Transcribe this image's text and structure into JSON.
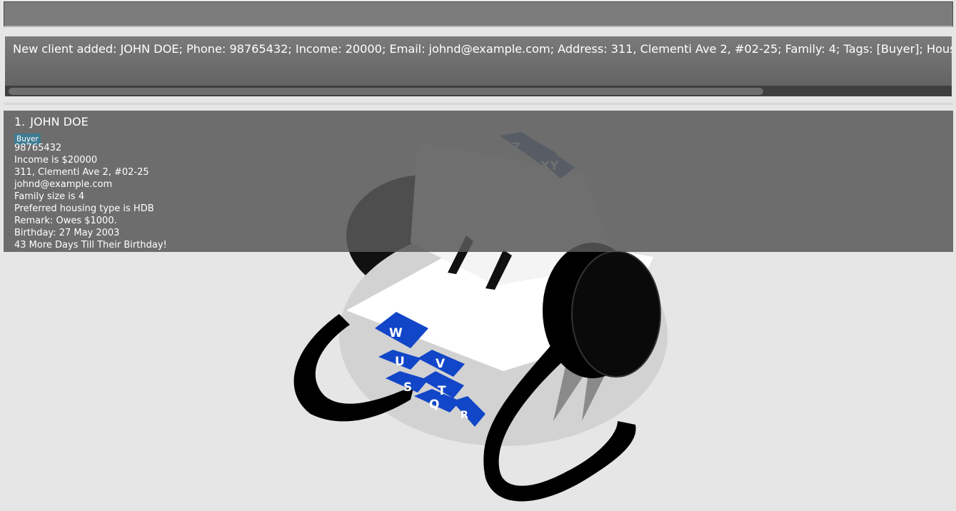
{
  "command_box": {
    "value": "",
    "placeholder": ""
  },
  "result_display": {
    "text": "New client added: JOHN DOE; Phone: 98765432; Income: 20000; Email: johnd@example.com; Address: 311, Clementi Ave 2, #02-25; Family: 4; Tags: [Buyer]; Housing type: HDB; Re"
  },
  "client_list": {
    "cards": [
      {
        "index": "1.",
        "name": "JOHN DOE",
        "tags": [
          "Buyer"
        ],
        "phone": "98765432",
        "income": "Income is $20000",
        "address": "311, Clementi Ave 2, #02-25",
        "email": "johnd@example.com",
        "family": "Family size is 4",
        "housing": "Preferred housing type is HDB",
        "remark": "Remark: Owes $1000.",
        "birthday": "Birthday: 27 May 2003",
        "countdown": "43 More Days Till Their Birthday!"
      }
    ]
  },
  "background": {
    "icon": "rolodex-icon",
    "card_tab_letters": [
      "Z",
      "XY",
      "W",
      "V",
      "U",
      "T",
      "S",
      "Q",
      "R"
    ]
  },
  "colors": {
    "background": "#e6e6e6",
    "panel": "#7b7b7b",
    "tag": "#3e7b91",
    "rolodex_tab": "#1246c8"
  }
}
